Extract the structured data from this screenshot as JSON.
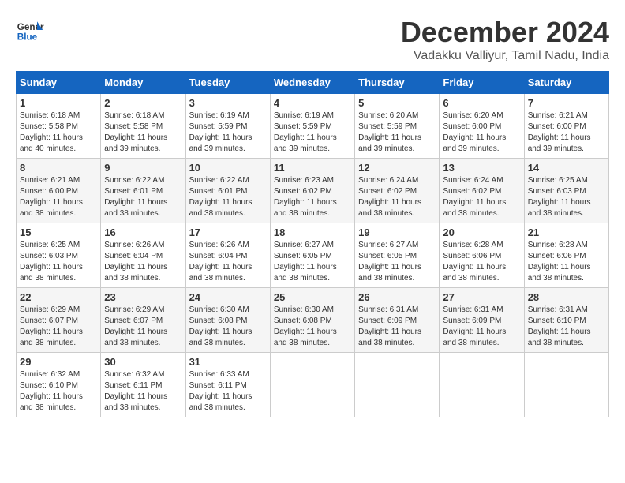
{
  "logo": {
    "line1": "General",
    "line2": "Blue"
  },
  "title": {
    "month": "December 2024",
    "location": "Vadakku Valliyur, Tamil Nadu, India"
  },
  "weekdays": [
    "Sunday",
    "Monday",
    "Tuesday",
    "Wednesday",
    "Thursday",
    "Friday",
    "Saturday"
  ],
  "weeks": [
    [
      {
        "day": "1",
        "sunrise": "6:18 AM",
        "sunset": "5:58 PM",
        "daylight": "11 hours and 40 minutes."
      },
      {
        "day": "2",
        "sunrise": "6:18 AM",
        "sunset": "5:58 PM",
        "daylight": "11 hours and 39 minutes."
      },
      {
        "day": "3",
        "sunrise": "6:19 AM",
        "sunset": "5:59 PM",
        "daylight": "11 hours and 39 minutes."
      },
      {
        "day": "4",
        "sunrise": "6:19 AM",
        "sunset": "5:59 PM",
        "daylight": "11 hours and 39 minutes."
      },
      {
        "day": "5",
        "sunrise": "6:20 AM",
        "sunset": "5:59 PM",
        "daylight": "11 hours and 39 minutes."
      },
      {
        "day": "6",
        "sunrise": "6:20 AM",
        "sunset": "6:00 PM",
        "daylight": "11 hours and 39 minutes."
      },
      {
        "day": "7",
        "sunrise": "6:21 AM",
        "sunset": "6:00 PM",
        "daylight": "11 hours and 39 minutes."
      }
    ],
    [
      {
        "day": "8",
        "sunrise": "6:21 AM",
        "sunset": "6:00 PM",
        "daylight": "11 hours and 38 minutes."
      },
      {
        "day": "9",
        "sunrise": "6:22 AM",
        "sunset": "6:01 PM",
        "daylight": "11 hours and 38 minutes."
      },
      {
        "day": "10",
        "sunrise": "6:22 AM",
        "sunset": "6:01 PM",
        "daylight": "11 hours and 38 minutes."
      },
      {
        "day": "11",
        "sunrise": "6:23 AM",
        "sunset": "6:02 PM",
        "daylight": "11 hours and 38 minutes."
      },
      {
        "day": "12",
        "sunrise": "6:24 AM",
        "sunset": "6:02 PM",
        "daylight": "11 hours and 38 minutes."
      },
      {
        "day": "13",
        "sunrise": "6:24 AM",
        "sunset": "6:02 PM",
        "daylight": "11 hours and 38 minutes."
      },
      {
        "day": "14",
        "sunrise": "6:25 AM",
        "sunset": "6:03 PM",
        "daylight": "11 hours and 38 minutes."
      }
    ],
    [
      {
        "day": "15",
        "sunrise": "6:25 AM",
        "sunset": "6:03 PM",
        "daylight": "11 hours and 38 minutes."
      },
      {
        "day": "16",
        "sunrise": "6:26 AM",
        "sunset": "6:04 PM",
        "daylight": "11 hours and 38 minutes."
      },
      {
        "day": "17",
        "sunrise": "6:26 AM",
        "sunset": "6:04 PM",
        "daylight": "11 hours and 38 minutes."
      },
      {
        "day": "18",
        "sunrise": "6:27 AM",
        "sunset": "6:05 PM",
        "daylight": "11 hours and 38 minutes."
      },
      {
        "day": "19",
        "sunrise": "6:27 AM",
        "sunset": "6:05 PM",
        "daylight": "11 hours and 38 minutes."
      },
      {
        "day": "20",
        "sunrise": "6:28 AM",
        "sunset": "6:06 PM",
        "daylight": "11 hours and 38 minutes."
      },
      {
        "day": "21",
        "sunrise": "6:28 AM",
        "sunset": "6:06 PM",
        "daylight": "11 hours and 38 minutes."
      }
    ],
    [
      {
        "day": "22",
        "sunrise": "6:29 AM",
        "sunset": "6:07 PM",
        "daylight": "11 hours and 38 minutes."
      },
      {
        "day": "23",
        "sunrise": "6:29 AM",
        "sunset": "6:07 PM",
        "daylight": "11 hours and 38 minutes."
      },
      {
        "day": "24",
        "sunrise": "6:30 AM",
        "sunset": "6:08 PM",
        "daylight": "11 hours and 38 minutes."
      },
      {
        "day": "25",
        "sunrise": "6:30 AM",
        "sunset": "6:08 PM",
        "daylight": "11 hours and 38 minutes."
      },
      {
        "day": "26",
        "sunrise": "6:31 AM",
        "sunset": "6:09 PM",
        "daylight": "11 hours and 38 minutes."
      },
      {
        "day": "27",
        "sunrise": "6:31 AM",
        "sunset": "6:09 PM",
        "daylight": "11 hours and 38 minutes."
      },
      {
        "day": "28",
        "sunrise": "6:31 AM",
        "sunset": "6:10 PM",
        "daylight": "11 hours and 38 minutes."
      }
    ],
    [
      {
        "day": "29",
        "sunrise": "6:32 AM",
        "sunset": "6:10 PM",
        "daylight": "11 hours and 38 minutes."
      },
      {
        "day": "30",
        "sunrise": "6:32 AM",
        "sunset": "6:11 PM",
        "daylight": "11 hours and 38 minutes."
      },
      {
        "day": "31",
        "sunrise": "6:33 AM",
        "sunset": "6:11 PM",
        "daylight": "11 hours and 38 minutes."
      },
      null,
      null,
      null,
      null
    ]
  ]
}
